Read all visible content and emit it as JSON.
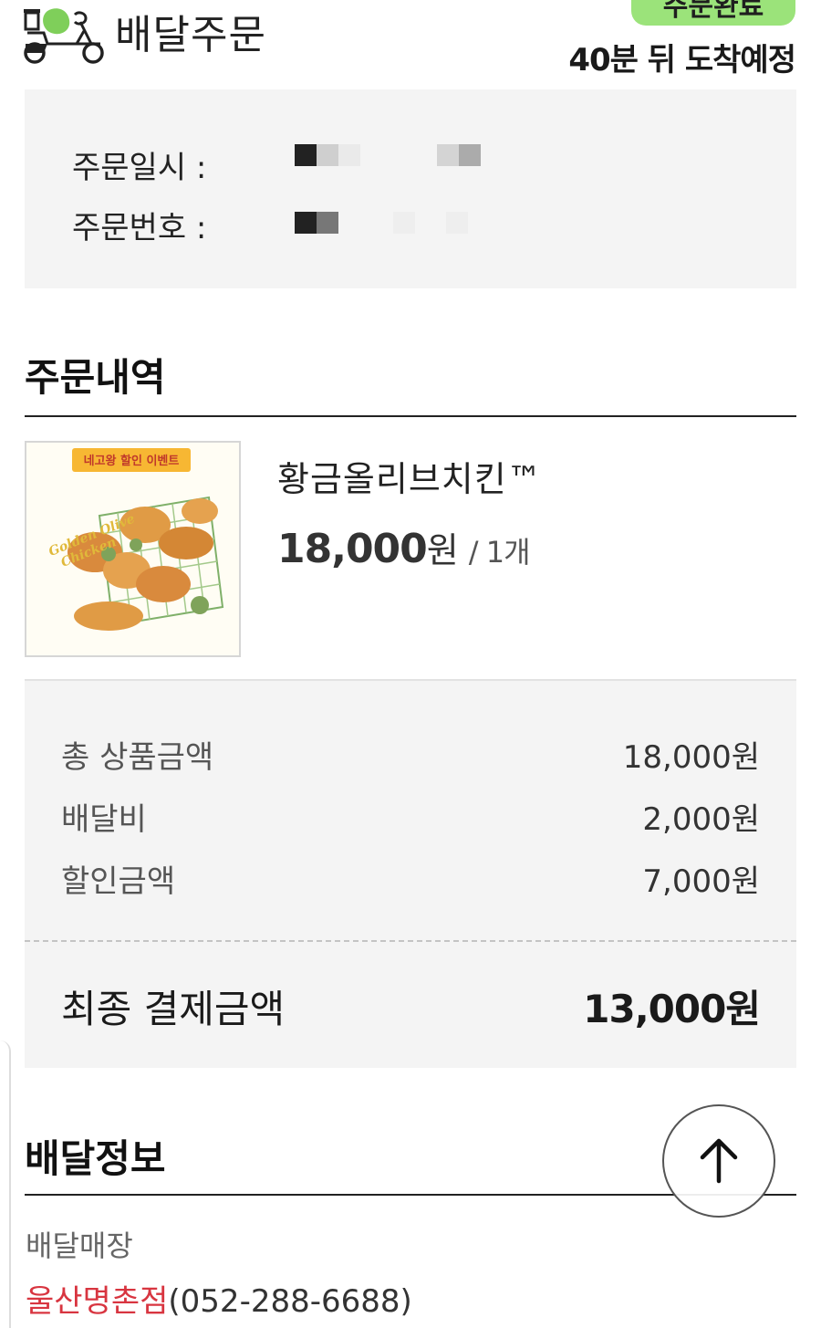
{
  "header": {
    "title": "배달주문",
    "status": "주문완료",
    "eta": "40분 뒤 도착예정",
    "icon": "delivery-scooter-icon"
  },
  "order_meta": {
    "date_label": "주문일시 :",
    "number_label": "주문번호 :"
  },
  "order_section": {
    "title": "주문내역",
    "product": {
      "name": "황금올리브치킨™",
      "price": "18,000",
      "currency": "원",
      "qty": "/ 1개",
      "image": {
        "banner": "네고왕 할인 이벤트",
        "caption_line1": "Golden Olive",
        "caption_line2": "Chicken"
      }
    }
  },
  "summary": {
    "rows": [
      {
        "label": "총 상품금액",
        "value": "18,000원"
      },
      {
        "label": "배달비",
        "value": "2,000원"
      },
      {
        "label": "할인금액",
        "value": "7,000원"
      }
    ],
    "total_label": "최종 결제금액",
    "total_value": "13,000원"
  },
  "delivery_section": {
    "title": "배달정보",
    "store_label": "배달매장",
    "store_name": "울산명촌점",
    "store_phone": "(052-288-6688)"
  },
  "colors": {
    "status_pill": "#9be37a",
    "store_name": "#d83540",
    "panel_bg": "#f4f4f4"
  }
}
